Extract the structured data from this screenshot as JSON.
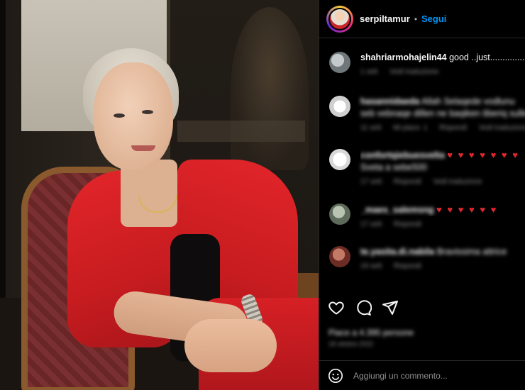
{
  "post": {
    "author": "serpiltamur",
    "separator": "•",
    "follow_label": "Segui"
  },
  "comments": [
    {
      "username": "shahriarmohajelin44",
      "text": "good ..just.................",
      "time": "1 sett",
      "likes": "",
      "reply": "",
      "translate": "Vedi traduzione",
      "blurred": false,
      "avatar_color": "#9aa3a6"
    },
    {
      "username": "hasannidaeda",
      "text": "Allah Selaqede vodlunu seb vebnaqe dillen ne baqiken tiberiq sulle",
      "time": "11 sett",
      "likes": "Mi piace: 1",
      "reply": "Rispondi",
      "translate": "Vedi traduzione",
      "blurred": true,
      "avatar_color": "#e9e9e9"
    },
    {
      "username": "confortqiebuesvelta",
      "text": "♥ ♥ ♥ ♥ ♥ ♥ ♥",
      "text2": "Sveta a sebe500",
      "time": "17 sett",
      "likes": "",
      "reply": "Rispondi",
      "translate": "Vedi traduzione",
      "blurred": true,
      "avatar_color": "#f1f1f1"
    },
    {
      "username": "_maes_salemsng",
      "text": "♥ ♥ ♥ ♥ ♥ ♥",
      "time": "17 sett",
      "likes": "",
      "reply": "Rispondi",
      "translate": "",
      "blurred": true,
      "avatar_color": "#8d9a8c"
    },
    {
      "username": "te.yasita.di.nabila",
      "text": "Bravissima attrice",
      "time": "19 sett",
      "likes": "",
      "reply": "Rispondi",
      "translate": "",
      "blurred": true,
      "avatar_color": "#a04b3f"
    }
  ],
  "actions": {
    "like_icon": "heart-icon",
    "comment_icon": "comment-icon",
    "share_icon": "share-icon"
  },
  "likes_text": "Piace a 4.395 persone",
  "date_text": "18 ottobre 2022",
  "add_comment": {
    "emoji_icon": "emoji-icon",
    "placeholder": "Aggiungi un commento..."
  },
  "colors": {
    "background": "#000000",
    "follow": "#0095f6",
    "heart": "#e0262f",
    "muted": "#8e8e8e"
  }
}
